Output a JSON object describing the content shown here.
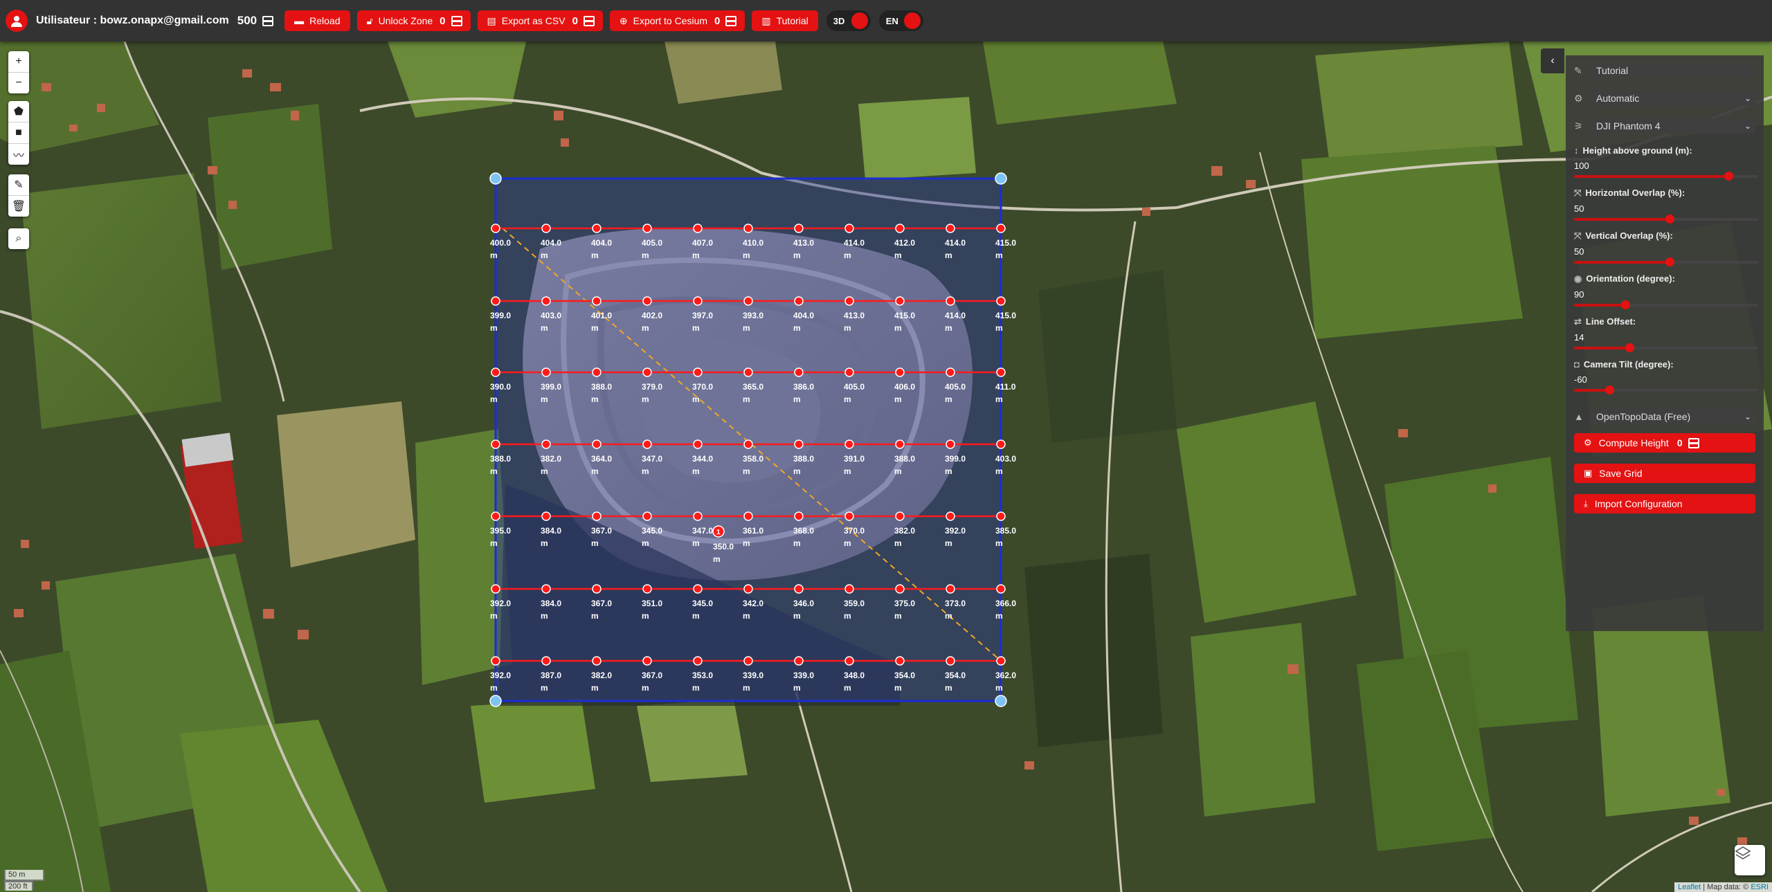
{
  "header": {
    "user_label": "Utilisateur : bowz.onapx@gmail.com",
    "credits": "500",
    "buttons": [
      {
        "label": "Reload",
        "icon": "reload-icon"
      },
      {
        "label": "Unlock Zone",
        "icon": "unlock-icon",
        "count": "0"
      },
      {
        "label": "Export as CSV",
        "icon": "file-icon",
        "count": "0"
      },
      {
        "label": "Export to Cesium",
        "icon": "globe-icon",
        "count": "0"
      },
      {
        "label": "Tutorial",
        "icon": "book-icon"
      }
    ],
    "toggle_3d": "3D",
    "toggle_lang": "EN"
  },
  "map": {
    "grid_rows": [
      [
        "400.0",
        "404.0",
        "404.0",
        "405.0",
        "407.0",
        "410.0",
        "413.0",
        "414.0",
        "412.0",
        "414.0",
        "415.0"
      ],
      [
        "399.0",
        "403.0",
        "401.0",
        "402.0",
        "397.0",
        "393.0",
        "404.0",
        "413.0",
        "415.0",
        "414.0",
        "415.0"
      ],
      [
        "390.0",
        "399.0",
        "388.0",
        "379.0",
        "370.0",
        "365.0",
        "386.0",
        "405.0",
        "406.0",
        "405.0",
        "411.0"
      ],
      [
        "388.0",
        "382.0",
        "364.0",
        "347.0",
        "344.0",
        "358.0",
        "388.0",
        "391.0",
        "388.0",
        "399.0",
        "403.0"
      ],
      [
        "395.0",
        "384.0",
        "367.0",
        "345.0",
        "347.0",
        "361.0",
        "368.0",
        "370.0",
        "382.0",
        "392.0",
        "385.0"
      ],
      [
        "392.0",
        "384.0",
        "367.0",
        "351.0",
        "345.0",
        "342.0",
        "346.0",
        "359.0",
        "375.0",
        "373.0",
        "366.0"
      ],
      [
        "392.0",
        "387.0",
        "382.0",
        "367.0",
        "353.0",
        "339.0",
        "339.0",
        "348.0",
        "354.0",
        "354.0",
        "362.0"
      ]
    ],
    "unit": "m",
    "extra_point_value": "350.0",
    "extra_point_number": "1",
    "scale_metric": "50 m",
    "scale_imperial": "200 ft",
    "attribution_leaflet": "Leaflet",
    "attribution_rest": "| Map data: ©",
    "attribution_esri": "ESRI"
  },
  "panel": {
    "mission_name": "Tutorial",
    "mode": "Automatic",
    "drone": "DJI Phantom 4",
    "fields": [
      {
        "label": "Height above ground (m):",
        "value": "100",
        "fraction": 0.84
      },
      {
        "label": "Horizontal Overlap (%):",
        "value": "50",
        "fraction": 0.52
      },
      {
        "label": "Vertical Overlap (%):",
        "value": "50",
        "fraction": 0.52
      },
      {
        "label": "Orientation (degree):",
        "value": "90",
        "fraction": 0.28
      },
      {
        "label": "Line Offset:",
        "value": "14",
        "fraction": 0.3
      },
      {
        "label": "Camera Tilt (degree):",
        "value": "-60",
        "fraction": 0.19
      }
    ],
    "elevation_source": "OpenTopoData (Free)",
    "compute_height": "Compute Height",
    "compute_count": "0",
    "save_grid": "Save Grid",
    "import_config": "Import Configuration"
  },
  "colors": {
    "accent": "#e41212",
    "grid_line": "#ff1a1a",
    "zone_border": "#1a2dd6",
    "zone_fill": "#2a3a9a",
    "diagonal": "#f5a623"
  }
}
